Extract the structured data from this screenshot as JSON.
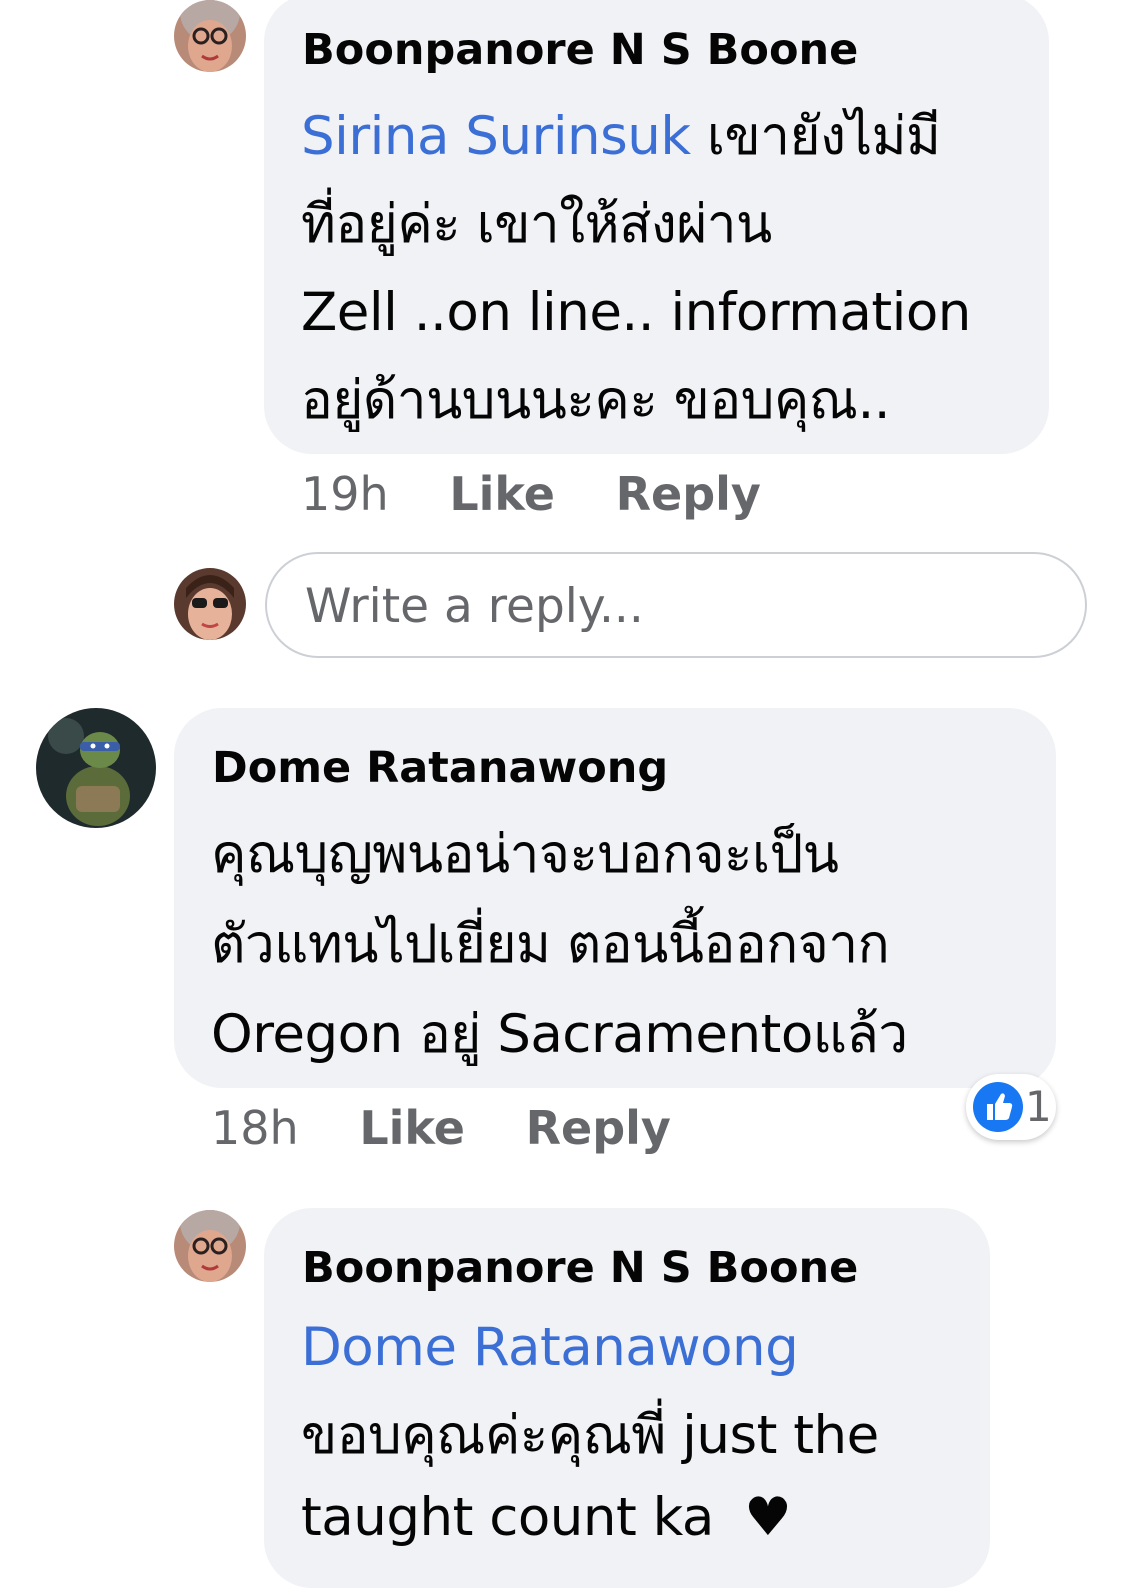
{
  "comments": [
    {
      "author": "Boonpanore N S Boone",
      "mention": "Sirina Surinsuk",
      "lines": [
        "เขายังไม่มี",
        "ที่อยู่ค่ะ เขาให้ส่งผ่าน",
        "Zell ..on line.. information",
        "อยู่ด้านบนนะคะ ขอบคุณ.."
      ],
      "time": "19h",
      "like_label": "Like",
      "reply_label": "Reply"
    },
    {
      "author": "Dome Ratanawong",
      "lines": [
        "คุณบุญพนอน่าจะบอกจะเป็น",
        "ตัวแทนไปเยี่ยม ตอนนี้ออกจาก",
        "Oregon อยู่ Sacramentoแล้ว"
      ],
      "time": "18h",
      "like_label": "Like",
      "reply_label": "Reply",
      "reaction_count": "1"
    },
    {
      "author": "Boonpanore N S Boone",
      "mention": "Dome Ratanawong",
      "lines": [
        "ขอบคุณค่ะคุณพี่ just the",
        "taught count ka"
      ],
      "heart": "♥"
    }
  ],
  "reply_box": {
    "placeholder": "Write a reply..."
  },
  "colors": {
    "bubble": "#f0f2f5",
    "mention": "#3b6fd6",
    "meta": "#65676b",
    "like_reaction": "#1877f2"
  },
  "icons": {
    "avatar_boonpanore": "avatar-photo",
    "avatar_dome": "avatar-photo-turtle",
    "like_reaction": "thumbs-up-icon",
    "heart": "heart-icon"
  }
}
